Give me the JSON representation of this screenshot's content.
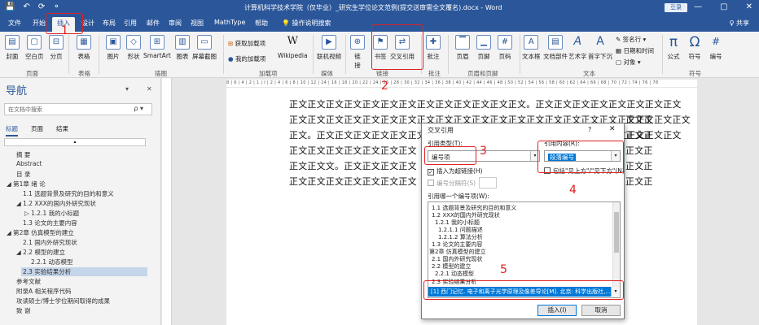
{
  "titlebar": {
    "quick_access": [
      "💾",
      "↶",
      "⟳",
      "⚬"
    ],
    "doc_title": "计算机科学技术学院（仅毕业）_研究生学位论文范例(提交送审需全文覆名).docx - Word",
    "login": "登录",
    "window_controls": [
      "▭",
      "—",
      "▢",
      "✕"
    ]
  },
  "menu": {
    "tabs": [
      "文件",
      "开始",
      "插入",
      "设计",
      "布局",
      "引用",
      "邮件",
      "审阅",
      "视图",
      "MathType",
      "帮助",
      "💡 操作说明搜索"
    ],
    "share": "♀ 共享"
  },
  "ribbon": {
    "buttons": {
      "cover": "封面",
      "blank": "空白页",
      "pagebreak": "分页",
      "table": "表格",
      "picture": "图片",
      "shape": "形状",
      "smartart": "SmartArt",
      "chart": "图表",
      "screenshot": "屏幕截图",
      "get_addins": "获取加载项",
      "my_addins": "我的加载项",
      "wikipedia": "Wikipedia",
      "online_video": "联机视频",
      "link": "链接",
      "bookmark": "书签",
      "crossref": "交叉引用",
      "comment": "批注",
      "header": "页眉",
      "footer": "页脚",
      "page_number": "页码",
      "textbox": "文本框",
      "quickparts": "文档部件",
      "wordart": "艺术字",
      "dropcap": "首字下沉",
      "signature": "签名行",
      "datetime": "日期和时间",
      "object": "对象",
      "equation": "公式",
      "symbol": "符号",
      "number": "编号"
    },
    "groups": [
      "页面",
      "表格",
      "插图",
      "加载项",
      "媒体",
      "链接",
      "批注",
      "页眉和页脚",
      "文本",
      "符号"
    ],
    "glyphs": {
      "w": "W",
      "pi": "π",
      "omega": "Ω",
      "a_art": "A",
      "a_drop": "A"
    }
  },
  "nav": {
    "title": "导航",
    "controls": [
      "▾",
      "✕"
    ],
    "search_placeholder": "在文档中搜索",
    "search_icon": "ρ ▾",
    "tabs": [
      "标题",
      "页面",
      "结果"
    ],
    "scroll_arrow": "▴",
    "items": [
      "摘 要",
      "Abstract",
      "目 录",
      "◢ 第1章 绪 论",
      "1.1 选题背景及研究的目的和意义",
      "◢ 1.2 XXX的国内外研究现状",
      "▷ 1.2.1 我的小标题",
      "1.3 论文的主要内容",
      "◢ 第2章 仿真模型的建立",
      "2.1 国内外研究现状",
      "◢ 2.2 模型的建立",
      "2.2.1 动态模型",
      "2.3 实验结果分析",
      "参考文献",
      "附录A 相关程序代码",
      "攻读硕士/博士学位期间取得的成果",
      "致 谢"
    ]
  },
  "ruler_text": "8 | 6 | 4 | 2 | 1 | I | 2 | 4 | 6 | 8 | 10 | 12 | 14 | 16 | 18 | 20 | 22 | 24 | 26 | 28 | 30 | 32 | 34 | 36 | 38 | 40 | 42 | 44 | 46 | 48 | 50 | 52 | 54 | 56 | 58 | 60 | 62 | 64 | 66 | 68 | 70 | 72 | 74 | 76 | 78",
  "document": {
    "lines": [
      "正文正文正文正文正文正文正文正文正文正文正文正文正文。正文正文正文正文正文正文正文正文",
      "正文正文正文正文正文正文正文正文正文正文正文正文正文正文正文正文正文正文正文正文正文正文",
      "正文。正文正文正文正文正文正文正文正文正文正文正文正文正文正文正文正文正文正文正文正文",
      "正文正文正文正文正文正文正文",
      "正文正文文。正文正文正文正文",
      "正文正文正文正文正文正文正文"
    ],
    "right_tail": [
      "正文正",
      "正文正",
      "正文正",
      "正文正",
      "正文正"
    ]
  },
  "dialog": {
    "title": "交叉引用",
    "help": "?",
    "close": "✕",
    "ref_type_label": "引用类型(T):",
    "ref_type_value": "编号项",
    "ref_content_label": "引用内容(R):",
    "ref_content_value": "段落编号",
    "insert_hyperlink": "插入为超链接(H)",
    "hyperlink_checked": "✓",
    "above_below": "包括\"见上方\"/\"见下方\"(N)",
    "separate_numbers": "编号分隔符(S)",
    "which_label": "引用哪一个编号项(W):",
    "list_items": [
      "1.1 选题背景及研究的目的和意义",
      "1.2 XXX的国内外研究现状",
      "1.2.1 我的小标题",
      "1.2.1.1 问题描述",
      "1.2.1.2 算法分析",
      "1.3 论文的主要内容",
      "第2章 仿真模型的建立",
      "2.1 国内外研究现状",
      "2.2 模型的建立",
      "2.2.1 动态模型",
      "2.3 实验结果分析"
    ],
    "selected_item": "[1] 西门记忆. 电子和离子光学原理及像差导论[M]. 北京: 科学出版社,...",
    "insert_button": "插入(I)",
    "cancel_button": "取消"
  },
  "annotations": [
    "1",
    "2",
    "3",
    "4",
    "5"
  ]
}
